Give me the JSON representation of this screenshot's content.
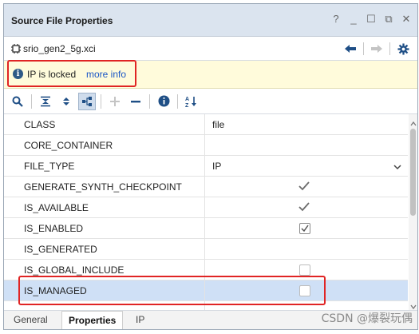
{
  "window": {
    "title": "Source File Properties",
    "controls": [
      "?",
      "_",
      "☐",
      "⧉",
      "✕"
    ]
  },
  "file": {
    "name": "srio_gen2_5g.xci",
    "icon": "ip-core-icon"
  },
  "info": {
    "icon": "info-icon",
    "message": "IP is locked",
    "link": "more info"
  },
  "toolbar": {
    "icons": [
      "search-icon",
      "collapse-all-icon",
      "expand-all-icon",
      "group-by-category-icon",
      "add-icon",
      "remove-icon",
      "info-icon",
      "sort-az-icon"
    ],
    "sort_label": "A↓Z"
  },
  "properties": [
    {
      "name": "CLASS",
      "value": "file",
      "kind": "text"
    },
    {
      "name": "CORE_CONTAINER",
      "value": "",
      "kind": "text"
    },
    {
      "name": "FILE_TYPE",
      "value": "IP",
      "kind": "dropdown"
    },
    {
      "name": "GENERATE_SYNTH_CHECKPOINT",
      "value": "",
      "kind": "tick"
    },
    {
      "name": "IS_AVAILABLE",
      "value": "",
      "kind": "tick"
    },
    {
      "name": "IS_ENABLED",
      "value": "",
      "kind": "checkbox-checked"
    },
    {
      "name": "IS_GENERATED",
      "value": "",
      "kind": "text"
    },
    {
      "name": "IS_GLOBAL_INCLUDE",
      "value": "",
      "kind": "checkbox"
    },
    {
      "name": "IS_MANAGED",
      "value": "",
      "kind": "checkbox",
      "selected": true
    }
  ],
  "tabs": [
    {
      "label": "General",
      "active": false
    },
    {
      "label": "Properties",
      "active": true
    },
    {
      "label": "IP",
      "active": false
    }
  ],
  "watermark": "CSDN @爆裂玩偶",
  "colors": {
    "title_bg": "#dbe4ef",
    "info_bg": "#fffbdb",
    "selected_row": "#cfe0f6",
    "highlight_box": "#e02424",
    "link": "#1a56c6"
  }
}
